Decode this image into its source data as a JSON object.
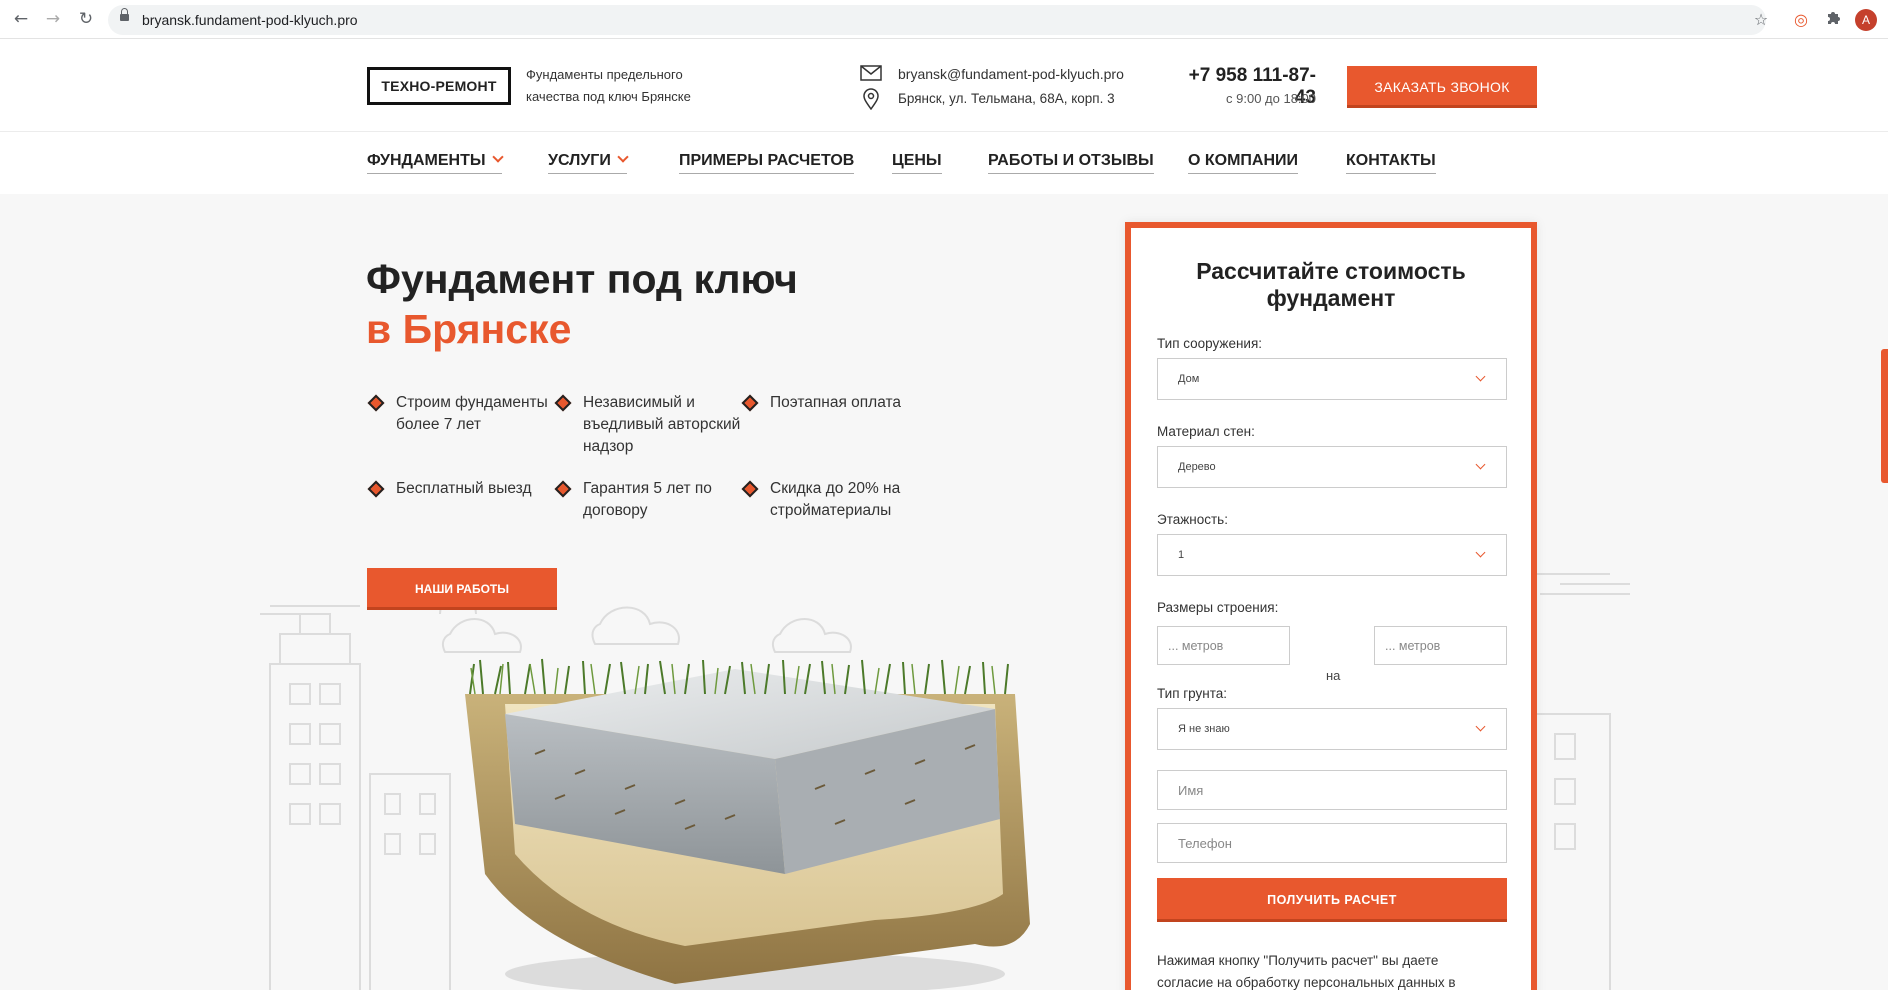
{
  "browser": {
    "url": "bryansk.fundament-pod-klyuch.pro",
    "avatar_letter": "A",
    "icons": [
      "back-arrow-icon",
      "forward-arrow-icon",
      "reload-icon",
      "lock-icon",
      "star-icon",
      "target-extension-icon",
      "puzzle-extension-icon"
    ]
  },
  "header": {
    "logo": "ТЕХНО-РЕМОНТ",
    "tagline": "Фундаменты предельного качества под ключ Брянске",
    "email": "bryansk@fundament-pod-klyuch.pro",
    "address": "Брянск, ул. Тельмана, 68А, корп. 3",
    "phone": "+7 958 111-87-43",
    "hours": "с 9:00 до 18:00",
    "call_button": "ЗАКАЗАТЬ ЗВОНОК"
  },
  "nav": {
    "items": [
      {
        "label": "ФУНДАМЕНТЫ",
        "dropdown": true
      },
      {
        "label": "УСЛУГИ",
        "dropdown": true
      },
      {
        "label": "ПРИМЕРЫ РАСЧЕТОВ",
        "dropdown": false
      },
      {
        "label": "ЦЕНЫ",
        "dropdown": false
      },
      {
        "label": "РАБОТЫ И ОТЗЫВЫ",
        "dropdown": false
      },
      {
        "label": "О КОМПАНИИ",
        "dropdown": false
      },
      {
        "label": "КОНТАКТЫ",
        "dropdown": false
      }
    ]
  },
  "hero": {
    "title_line1": "Фундамент под ключ",
    "title_line2": "в Брянске",
    "features": [
      "Строим фундаменты более 7 лет",
      "Независимый и въедливый авторский надзор",
      "Поэтапная оплата",
      "Бесплатный выезд",
      "Гарантия 5 лет по договору",
      "Скидка до 20% на стройматериалы"
    ],
    "works_button": "НАШИ РАБОТЫ"
  },
  "form": {
    "title": "Рассчитайте стоимость фундамент",
    "structure_label": "Тип сооружения:",
    "structure_value": "Дом",
    "wall_label": "Материал стен:",
    "wall_value": "Дерево",
    "floors_label": "Этажность:",
    "floors_value": "1",
    "size_label": "Размеры строения:",
    "size_placeholder_1": "... метров",
    "size_sep": "на",
    "size_placeholder_2": "... метров",
    "soil_label": "Тип грунта:",
    "soil_value": "Я не знаю",
    "name_placeholder": "Имя",
    "phone_placeholder": "Телефон",
    "submit": "ПОЛУЧИТЬ РАСЧЕТ",
    "consent": "Нажимая кнопку \"Получить расчет\" вы даете согласие на обработку персональных данных в"
  },
  "colors": {
    "accent": "#e8582e",
    "accent_dark": "#c2441e",
    "text": "#222222",
    "background": "#f7f7f7"
  }
}
